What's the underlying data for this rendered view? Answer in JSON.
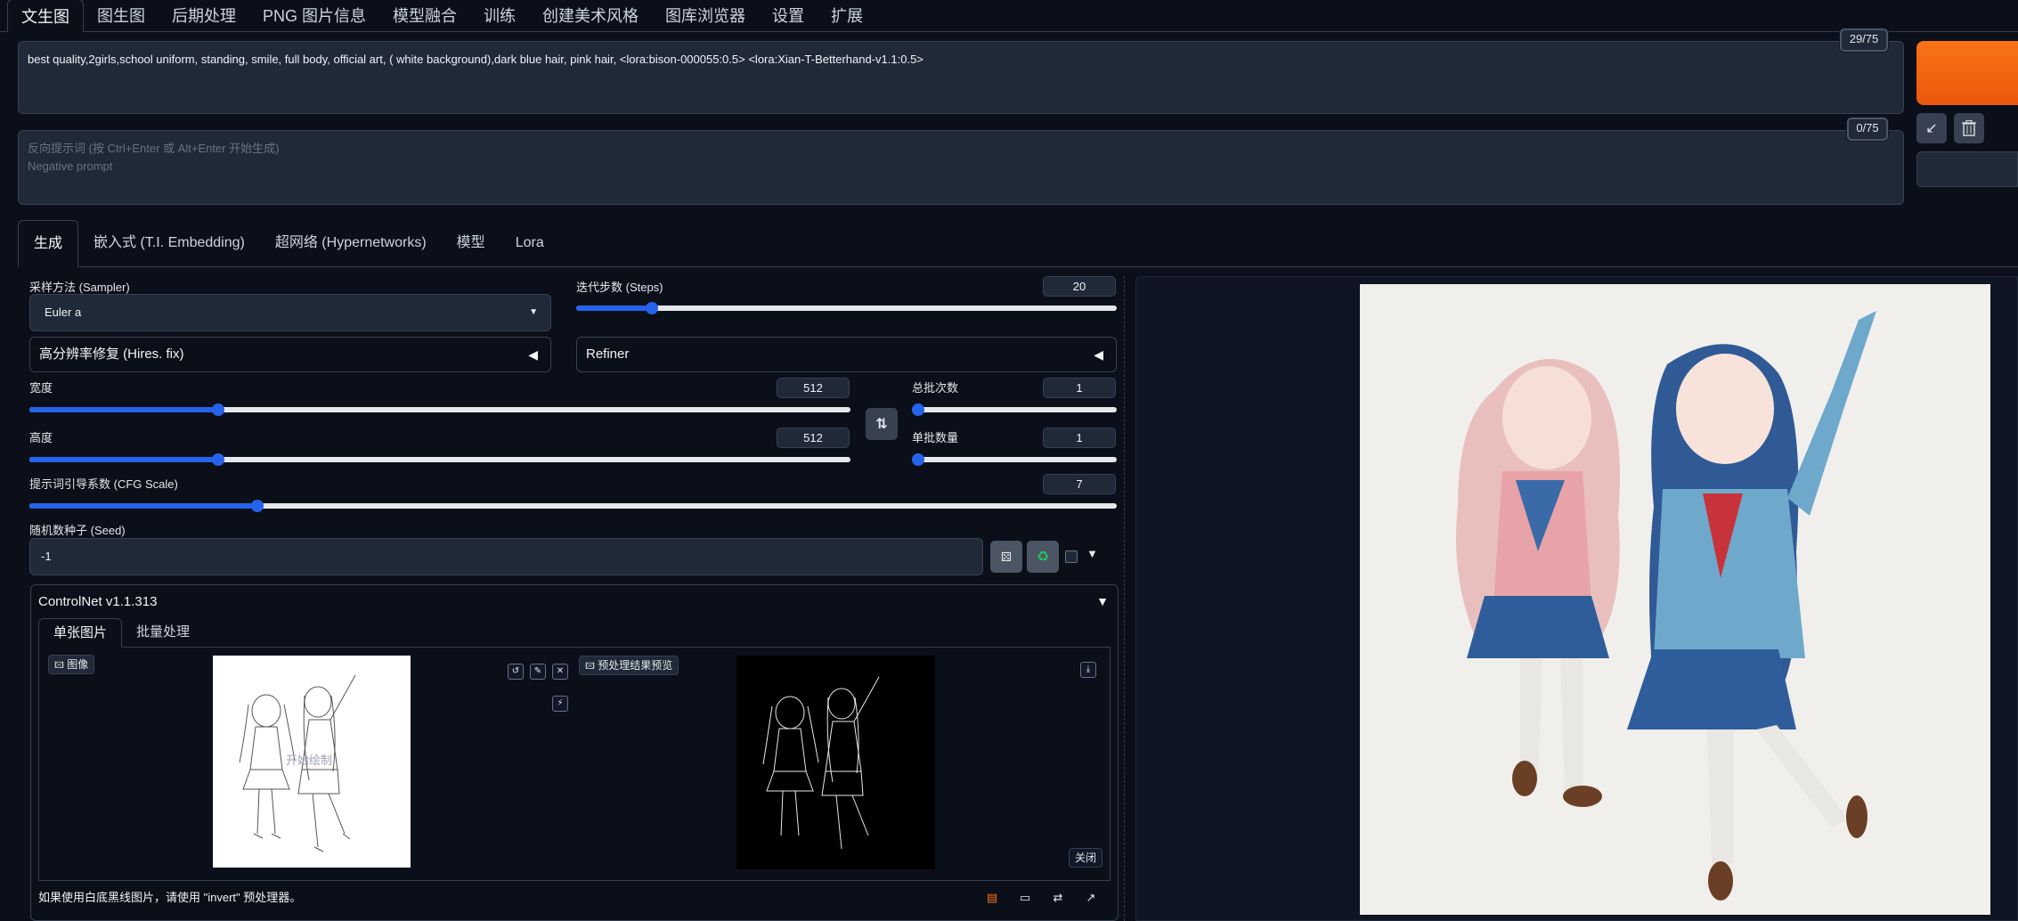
{
  "top_tabs": [
    "文生图",
    "图生图",
    "后期处理",
    "PNG 图片信息",
    "模型融合",
    "训练",
    "创建美术风格",
    "图库浏览器",
    "设置",
    "扩展"
  ],
  "prompt": {
    "positive": "best quality,2girls,school uniform, standing, smile, full body, official art, ( white background),dark blue hair, pink hair,  <lora:bison-000055:0.5> <lora:Xian-T-Betterhand-v1.1:0.5>",
    "positive_counter": "29/75",
    "negative_line1": "反向提示词 (按 Ctrl+Enter 或 Alt+Enter 开始生成)",
    "negative_line2": "Negative prompt",
    "negative_counter": "0/75"
  },
  "tools": {
    "apply_icon": "arrow-down-left-icon",
    "trash_icon": "trash-icon"
  },
  "sub_tabs": [
    "生成",
    "嵌入式 (T.I. Embedding)",
    "超网络 (Hypernetworks)",
    "模型",
    "Lora"
  ],
  "params": {
    "sampler_label": "采样方法 (Sampler)",
    "sampler_value": "Euler a",
    "steps_label": "迭代步数 (Steps)",
    "steps_value": "20",
    "steps_fraction": 0.14,
    "hires_label": "高分辨率修复 (Hires. fix)",
    "refiner_label": "Refiner",
    "width_label": "宽度",
    "width_value": "512",
    "width_fraction": 0.23,
    "height_label": "高度",
    "height_value": "512",
    "height_fraction": 0.23,
    "batch_count_label": "总批次数",
    "batch_count_value": "1",
    "batch_size_label": "单批数量",
    "batch_size_value": "1",
    "cfg_label": "提示词引导系数 (CFG Scale)",
    "cfg_value": "7",
    "cfg_fraction": 0.21,
    "seed_label": "随机数种子 (Seed)",
    "seed_value": "-1"
  },
  "controlnet": {
    "title": "ControlNet v1.1.313",
    "tabs": [
      "单张图片",
      "批量处理"
    ],
    "image_label": "图像",
    "preview_label": "预处理结果预览",
    "watermark": "开始绘制",
    "close_label": "关闭",
    "hint": "如果使用白底黑线图片，请使用 \"invert\" 预处理器。"
  },
  "colors": {
    "accent": "#2563eb",
    "generate": "#f97316",
    "background": "#0b0f19"
  }
}
